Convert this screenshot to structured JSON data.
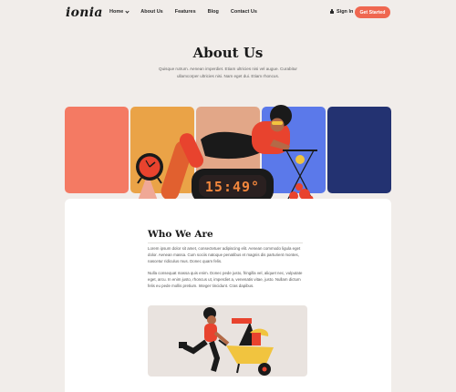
{
  "header": {
    "logo": "ionia",
    "nav": [
      {
        "label": "Home",
        "has_dropdown": true
      },
      {
        "label": "About Us"
      },
      {
        "label": "Features"
      },
      {
        "label": "Blog"
      },
      {
        "label": "Contact Us"
      }
    ],
    "signin_label": "Sign In",
    "cta_label": "Get Started"
  },
  "hero": {
    "title": "About Us",
    "subtitle": "Quisque rutrum. Aenean imperdiet. Etiam ultricies nisi vel augue. Curabitur ullamcorper ultricies nisi. Nam eget dui. Etiam rhoncus.",
    "clock_display": "15:49°"
  },
  "colors": {
    "accent": "#ef6750",
    "tiles": [
      "#f47a63",
      "#eaa347",
      "#e2a788",
      "#5b79ea",
      "#233271"
    ]
  },
  "section": {
    "title": "Who We Are",
    "paragraph1": "Lorem ipsum dolor sit amet, consectetuer adipiscing elit. Aenean commodo ligula eget dolor. Aenean massa. Cum sociis natoque penatibus et magnis dis parturient montes, nascetur ridiculus mus. Donec quam felis.",
    "paragraph2": "Nulla consequat massa quis enim. Donec pede justo, fringilla vel, aliquet nec, vulputate eget, arcu. In enim justo, rhoncus ut, imperdiet a, venenatis vitae, justo. Nullam dictum felis eu pede mollis pretium. Integer tincidunt. Cras dapibus."
  }
}
